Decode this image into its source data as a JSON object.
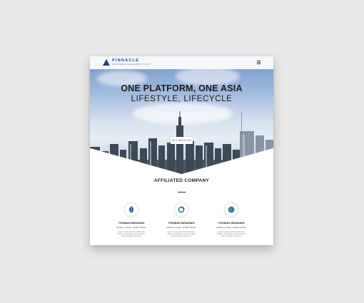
{
  "brand": {
    "name": "PINNACLE",
    "tagline": "INVESTMENT MANAGEMENT GROUP"
  },
  "hero": {
    "headline": "ONE PLATFORM, ONE ASIA",
    "subline": "LIFESTYLE, LIFECYCLE",
    "cta_label": "LET WITH US"
  },
  "affiliated": {
    "title": "AFFILIATED COMPANY",
    "companies": [
      {
        "name": "THOMAS BRADWN",
        "tag": "MORE CLASSIC, MORE SMART",
        "desc_1": "giá dermesal skoshnd sunhreuitá",
        "desc_2": "ahtàke zardhdahan enoteka inhahd",
        "desc_3": "dhén tohoeldin ichn doos",
        "icon": "globe-icon"
      },
      {
        "name": "THOMAS BRADWN",
        "tag": "MORE CLASSIC, MORE SMART",
        "desc_1": "giá dermesal skoshnd sunhreuitá",
        "desc_2": "ahtàke zardhdahan enoteka inhahd",
        "desc_3": "dhén tohoeldin ichn doos",
        "icon": "ring-icon"
      },
      {
        "name": "THOMAS BRADWN",
        "tag": "MORE CLASSIC, MORE SMART",
        "desc_1": "giá dermesal skoshnd sunhreuitá",
        "desc_2": "ahtàke zardhdahan enoteka inhahd",
        "desc_3": "dhén tohoeldin ichn doos",
        "icon": "earth-icon"
      }
    ]
  },
  "colors": {
    "brand": "#1f3f8f",
    "page_bg": "#e9e9e9",
    "card_bg": "#ffffff"
  }
}
